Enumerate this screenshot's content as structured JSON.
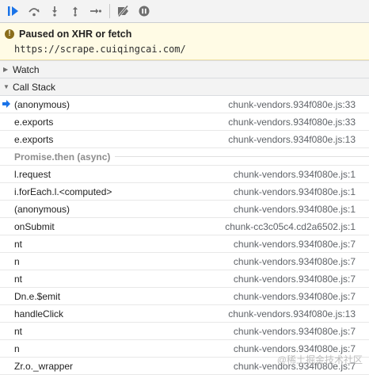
{
  "toolbar": {
    "buttons": [
      {
        "name": "resume-icon",
        "color": "#1a73e8"
      },
      {
        "name": "step-over-icon",
        "color": "#6e6e6e"
      },
      {
        "name": "step-into-icon",
        "color": "#6e6e6e"
      },
      {
        "name": "step-out-icon",
        "color": "#6e6e6e"
      },
      {
        "name": "step-icon",
        "color": "#6e6e6e"
      },
      {
        "name": "deactivate-breakpoints-icon",
        "color": "#6e6e6e"
      },
      {
        "name": "pause-on-exceptions-icon",
        "color": "#6e6e6e"
      }
    ]
  },
  "paused": {
    "title": "Paused on XHR or fetch",
    "url": "https://scrape.cuiqingcai.com/"
  },
  "watch": {
    "label": "Watch"
  },
  "call_stack": {
    "label": "Call Stack",
    "frames": [
      {
        "fn": "(anonymous)",
        "loc": "chunk-vendors.934f080e.js:33",
        "current": true
      },
      {
        "fn": "e.exports",
        "loc": "chunk-vendors.934f080e.js:33"
      },
      {
        "fn": "e.exports",
        "loc": "chunk-vendors.934f080e.js:13"
      }
    ],
    "async_label": "Promise.then (async)",
    "async_frames": [
      {
        "fn": "l.request",
        "loc": "chunk-vendors.934f080e.js:1"
      },
      {
        "fn": "i.forEach.l.<computed>",
        "loc": "chunk-vendors.934f080e.js:1"
      },
      {
        "fn": "(anonymous)",
        "loc": "chunk-vendors.934f080e.js:1"
      },
      {
        "fn": "onSubmit",
        "loc": "chunk-cc3c05c4.cd2a6502.js:1"
      },
      {
        "fn": "nt",
        "loc": "chunk-vendors.934f080e.js:7"
      },
      {
        "fn": "n",
        "loc": "chunk-vendors.934f080e.js:7"
      },
      {
        "fn": "nt",
        "loc": "chunk-vendors.934f080e.js:7"
      },
      {
        "fn": "Dn.e.$emit",
        "loc": "chunk-vendors.934f080e.js:7"
      },
      {
        "fn": "handleClick",
        "loc": "chunk-vendors.934f080e.js:13"
      },
      {
        "fn": "nt",
        "loc": "chunk-vendors.934f080e.js:7"
      },
      {
        "fn": "n",
        "loc": "chunk-vendors.934f080e.js:7"
      },
      {
        "fn": "Zr.o._wrapper",
        "loc": "chunk-vendors.934f080e.js:7"
      }
    ]
  },
  "watermark": "@稀土掘金技术社区"
}
